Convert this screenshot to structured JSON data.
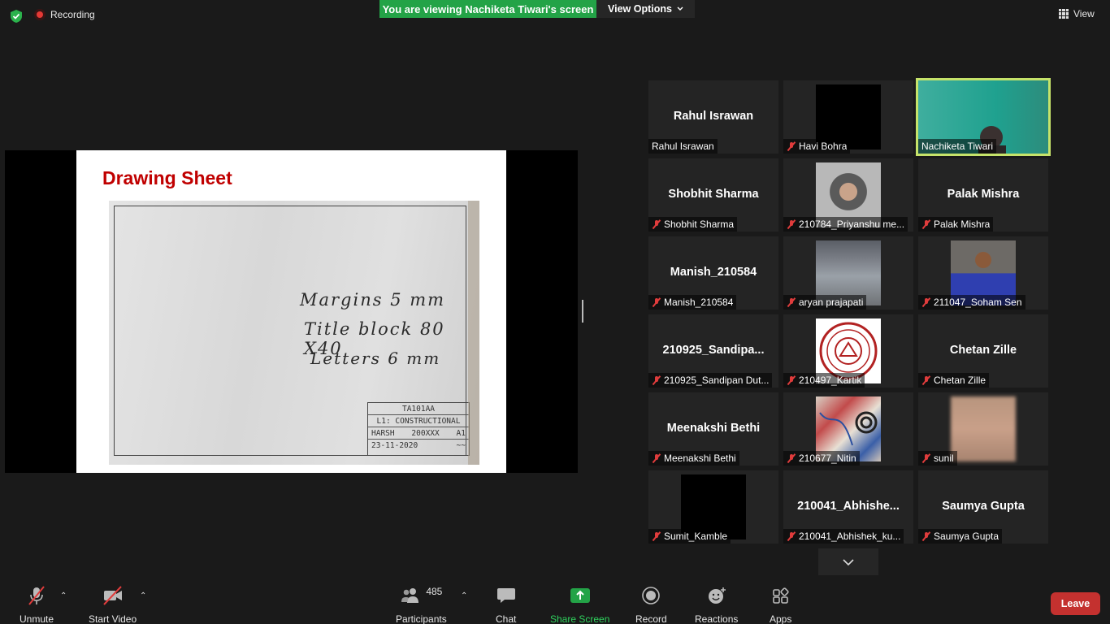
{
  "topbar": {
    "recording_label": "Recording",
    "viewing_banner": "You are viewing Nachiketa Tiwari's screen",
    "view_options_label": "View Options",
    "view_label": "View"
  },
  "slide": {
    "title": "Drawing Sheet",
    "lines": [
      "Margins  5 mm",
      "Title block 80 X40",
      "Letters  6 mm"
    ],
    "title_block": [
      "TA101AA",
      "L1: CONSTRUCTIONAL",
      "HARSH",
      "200XXX",
      "A1",
      "23-11-2020"
    ]
  },
  "participants": [
    {
      "big": "Rahul Israwan",
      "label": "Rahul Israwan",
      "muted": false,
      "kind": "name"
    },
    {
      "big": "",
      "label": "Havi Bohra",
      "muted": true,
      "kind": "black"
    },
    {
      "big": "",
      "label": "Nachiketa Tiwari",
      "muted": false,
      "kind": "teal",
      "active": true
    },
    {
      "big": "Shobhit Sharma",
      "label": "Shobhit Sharma",
      "muted": true,
      "kind": "name"
    },
    {
      "big": "",
      "label": "210784_Priyanshu me...",
      "muted": true,
      "kind": "hood"
    },
    {
      "big": "Palak Mishra",
      "label": "Palak Mishra",
      "muted": true,
      "kind": "name"
    },
    {
      "big": "Manish_210584",
      "label": "Manish_210584",
      "muted": true,
      "kind": "name"
    },
    {
      "big": "",
      "label": "aryan prajapati",
      "muted": true,
      "kind": "bridge"
    },
    {
      "big": "",
      "label": "211047_Soham Sen",
      "muted": true,
      "kind": "person"
    },
    {
      "big": "210925_Sandipa...",
      "label": "210925_Sandipan Dut...",
      "muted": true,
      "kind": "name"
    },
    {
      "big": "",
      "label": "210497_Kartik",
      "muted": true,
      "kind": "logo"
    },
    {
      "big": "Chetan Zille",
      "label": "Chetan Zille",
      "muted": true,
      "kind": "name"
    },
    {
      "big": "Meenakshi Bethi",
      "label": "Meenakshi Bethi",
      "muted": true,
      "kind": "name"
    },
    {
      "big": "",
      "label": "210677_Nitin",
      "muted": true,
      "kind": "art"
    },
    {
      "big": "",
      "label": "sunil",
      "muted": true,
      "kind": "blur"
    },
    {
      "big": "",
      "label": "Sumit_Kamble",
      "muted": true,
      "kind": "black"
    },
    {
      "big": "210041_Abhishe...",
      "label": "210041_Abhishek_ku...",
      "muted": true,
      "kind": "name"
    },
    {
      "big": "Saumya Gupta",
      "label": "Saumya Gupta",
      "muted": true,
      "kind": "name"
    }
  ],
  "toolbar": {
    "unmute": "Unmute",
    "start_video": "Start Video",
    "participants": "Participants",
    "participant_count": "485",
    "chat": "Chat",
    "share_screen": "Share Screen",
    "record": "Record",
    "reactions": "Reactions",
    "apps": "Apps",
    "leave": "Leave"
  },
  "colors": {
    "share_green": "#23a347",
    "leave_red": "#c4312f",
    "active_speaker": "#c6e36a",
    "muted_red": "#e03c3c"
  }
}
